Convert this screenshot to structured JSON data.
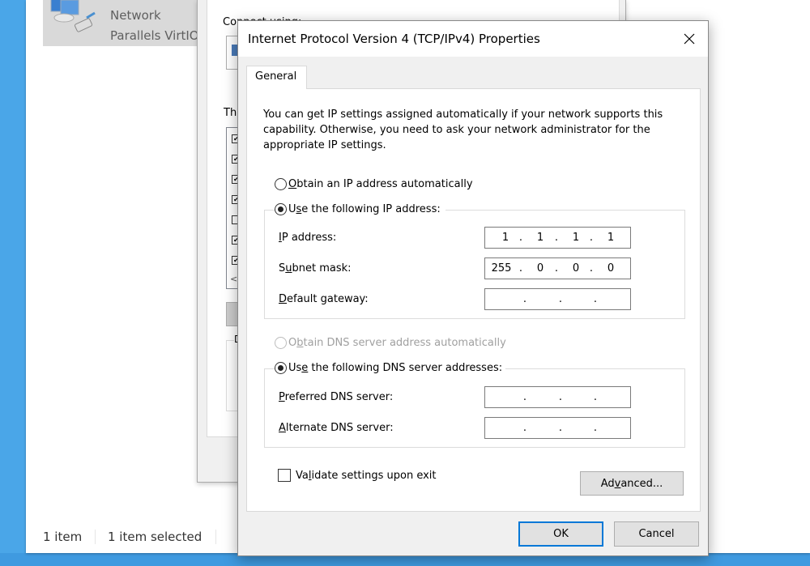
{
  "explorer": {
    "network_item": {
      "name": "Network",
      "description": "Parallels VirtIO"
    },
    "status": {
      "item_count": "1 item",
      "selected": "1 item selected"
    }
  },
  "background_window": {
    "connect_label": "Connect using:",
    "this_label": "Th",
    "desc_letter": "D",
    "list_checkboxes": [
      true,
      true,
      true,
      true,
      false,
      true,
      true
    ]
  },
  "dialog": {
    "title": "Internet Protocol Version 4 (TCP/IPv4) Properties",
    "close_icon": "close-icon",
    "tabs": [
      {
        "label": "General",
        "active": true
      }
    ],
    "intro": "You can get IP settings assigned automatically if your network supports this capability. Otherwise, you need to ask your network administrator for the appropriate IP settings.",
    "ip_auto": {
      "pre": "",
      "key": "O",
      "post": "btain an IP address automatically",
      "checked": false
    },
    "ip_manual": {
      "pre": "U",
      "key": "s",
      "post": "e the following IP address:",
      "checked": true
    },
    "ip_fields": [
      {
        "pre": "",
        "key": "I",
        "post": "P address:",
        "octets": [
          "1",
          "1",
          "1",
          "1"
        ]
      },
      {
        "pre": "S",
        "key": "u",
        "post": "bnet mask:",
        "octets": [
          "255",
          "0",
          "0",
          "0"
        ]
      },
      {
        "pre": "",
        "key": "D",
        "post": "efault gateway:",
        "octets": [
          "",
          "",
          "",
          ""
        ]
      }
    ],
    "dns_auto": {
      "pre": "O",
      "key": "b",
      "post": "tain DNS server address automatically",
      "checked": false,
      "disabled": true
    },
    "dns_manual": {
      "pre": "Us",
      "key": "e",
      "post": " the following DNS server addresses:",
      "checked": true
    },
    "dns_fields": [
      {
        "pre": "",
        "key": "P",
        "post": "referred DNS server:",
        "octets": [
          "",
          "",
          "",
          ""
        ]
      },
      {
        "pre": "",
        "key": "A",
        "post": "lternate DNS server:",
        "octets": [
          "",
          "",
          "",
          ""
        ]
      }
    ],
    "validate": {
      "pre": "Va",
      "key": "l",
      "post": "idate settings upon exit",
      "checked": false
    },
    "advanced": {
      "pre": "Ad",
      "key": "v",
      "post": "anced..."
    },
    "ok_label": "OK",
    "cancel_label": "Cancel"
  }
}
